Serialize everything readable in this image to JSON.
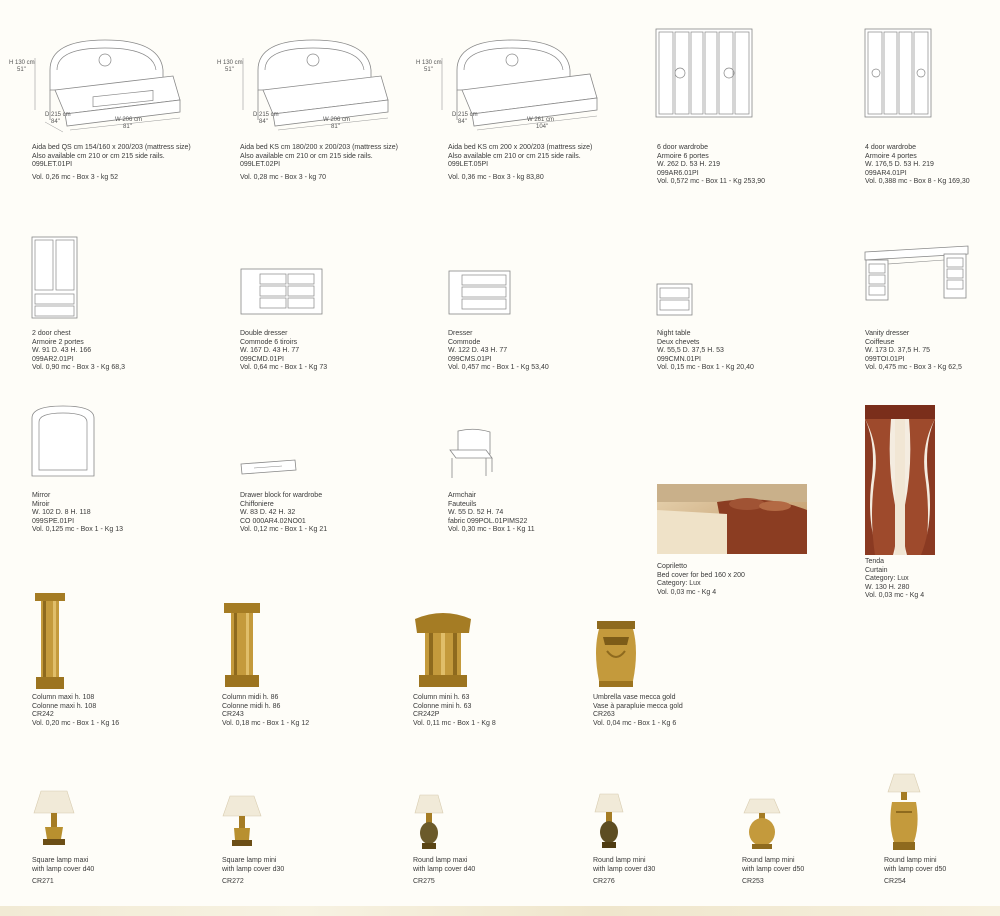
{
  "row1": [
    {
      "lines": [
        "Aida bed QS cm 154/160 x 200/203 (mattress size)",
        "Also available cm 210 or cm 215 side rails.",
        "099LET.01PI"
      ],
      "vol": "Vol. 0,26 mc - Box 3 - kg 52",
      "dims": {
        "h": "H 130 cm",
        "h_in": "51''",
        "d": "D 215 cm",
        "d_in": "84''",
        "w": "W 206 cm",
        "w_in": "81''"
      }
    },
    {
      "lines": [
        "Aida bed KS cm 180/200 x 200/203 (mattress size)",
        "Also available cm 210 or cm 215 side rails.",
        "099LET.02PI"
      ],
      "vol": "Vol. 0,28 mc - Box 3 - kg 70",
      "dims": {
        "h": "H 130 cm",
        "h_in": "51''",
        "d": "D 215 cm",
        "d_in": "84''",
        "w": "W 206 cm",
        "w_in": "81''"
      }
    },
    {
      "lines": [
        "Aida bed KS cm 200 x 200/203 (mattress size)",
        "Also available cm 210 or cm 215 side rails.",
        "099LET.05PI"
      ],
      "vol": "Vol. 0,36 mc - Box 3 - kg 83,80",
      "dims": {
        "h": "H 130 cm",
        "h_in": "51''",
        "d": "D 215 cm",
        "d_in": "84''",
        "w": "W 261 cm",
        "w_in": "104''"
      }
    },
    {
      "lines": [
        "6 door wardrobe",
        "Armoire 6 portes",
        "W. 262  D. 53  H. 219",
        "099AR6.01PI",
        "Vol. 0,572 mc - Box 11 - Kg 253,90"
      ]
    },
    {
      "lines": [
        "4 door wardrobe",
        "Armoire 4 portes",
        "W. 176,5  D. 53  H. 219",
        "099AR4.01PI",
        "Vol. 0,388 mc - Box 8 - Kg 169,30"
      ]
    }
  ],
  "row2": [
    {
      "lines": [
        "2 door chest",
        "Armoire 2 portes",
        "W. 91  D. 43  H. 166",
        "099AR2.01PI",
        "Vol. 0,90 mc - Box 3 - Kg 68,3"
      ]
    },
    {
      "lines": [
        "Double dresser",
        "Commode 6 tiroirs",
        "W. 167  D. 43  H. 77",
        "099CMD.01PI",
        "Vol. 0,64 mc - Box 1 - Kg 73"
      ]
    },
    {
      "lines": [
        "Dresser",
        "Commode",
        "W. 122  D. 43  H. 77",
        "099CMS.01PI",
        "Vol. 0,457 mc - Box 1 - Kg 53,40"
      ]
    },
    {
      "lines": [
        "Night table",
        "Deux chevets",
        "W. 55,5  D. 37,5  H. 53",
        "099CMN.01PI",
        "Vol. 0,15 mc - Box 1 - Kg 20,40"
      ]
    },
    {
      "lines": [
        "Vanity dresser",
        "Coiffeuse",
        "W. 173  D. 37,5  H. 75",
        "099TOI.01PI",
        "Vol. 0,475 mc - Box 3 - Kg 62,5"
      ]
    }
  ],
  "row3": [
    {
      "lines": [
        "Mirror",
        "Miroir",
        "W. 102  D. 8  H. 118",
        "099SPE.01PI",
        "Vol. 0,125 mc - Box 1 - Kg 13"
      ]
    },
    {
      "lines": [
        "Drawer block for wardrobe",
        "Chiffoniere",
        "W. 83  D. 42  H. 32",
        "CO 000AR4.02NO01",
        "Vol. 0,12 mc - Box 1 - Kg 21"
      ]
    },
    {
      "lines": [
        "Armchair",
        "Fauteuils",
        "W. 55  D. 52  H. 74",
        "fabric 099POL.01PIMS22",
        "Vol. 0,30 mc - Box 1 - Kg 11"
      ]
    },
    {
      "lines": [
        "Copriletto",
        "Bed cover for bed 160 x 200",
        "Category: Lux",
        "Vol. 0,03 mc - Kg 4"
      ]
    },
    {
      "lines": [
        "Tenda",
        "Curtain",
        "Category: Lux",
        "W. 130  H. 280",
        "Vol. 0,03 mc - Kg 4"
      ]
    }
  ],
  "row4": [
    {
      "lines": [
        "Column maxi h. 108",
        "Colonne maxi h. 108",
        "CR242",
        "Vol. 0,20 mc - Box 1 - Kg 16"
      ]
    },
    {
      "lines": [
        "Column midi h. 86",
        "Colonne midi h. 86",
        "CR243",
        "Vol. 0,18 mc - Box 1 - Kg 12"
      ]
    },
    {
      "lines": [
        "Column mini h. 63",
        "Colonne mini h. 63",
        "CR242P",
        "Vol. 0,11 mc - Box 1 - Kg 8"
      ]
    },
    {
      "lines": [
        "Umbrella vase mecca gold",
        "Vase à parapluie mecca gold",
        "CR263",
        "Vol. 0,04 mc - Box 1 - Kg 6"
      ]
    }
  ],
  "row5": [
    {
      "lines": [
        "Square lamp maxi",
        "with lamp cover d40"
      ],
      "code": "CR271"
    },
    {
      "lines": [
        "Square lamp mini",
        "with lamp cover d30"
      ],
      "code": "CR272"
    },
    {
      "lines": [
        "Round lamp maxi",
        "with lamp cover d40"
      ],
      "code": "CR275"
    },
    {
      "lines": [
        "Round lamp mini",
        "with lamp cover d30"
      ],
      "code": "CR276"
    },
    {
      "lines": [
        "Round lamp mini",
        "with lamp cover d50"
      ],
      "code": "CR253"
    },
    {
      "lines": [
        "Round lamp mini",
        "with lamp cover d50"
      ],
      "code": "CR254"
    }
  ],
  "colors": {
    "background": "#fefdf8",
    "gold": "#b8902f",
    "fabric": "#8a3a22",
    "text": "#3a3a3a"
  }
}
